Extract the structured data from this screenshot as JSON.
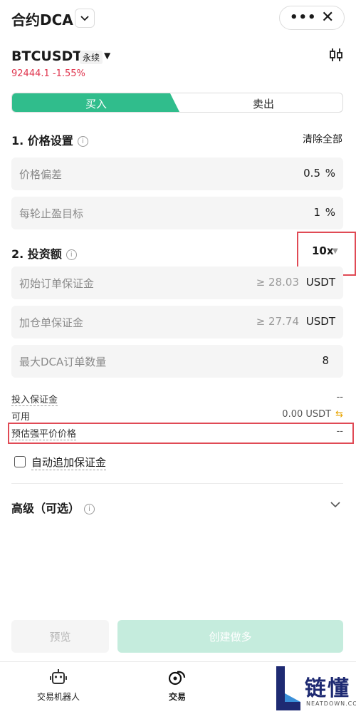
{
  "header": {
    "title": "合约DCA",
    "dropdown_icon": "chevron-down-icon",
    "more_icon": "more-dots-icon",
    "close_icon": "close-icon",
    "more_glyph": "•••",
    "close_glyph": "✕"
  },
  "instrument": {
    "symbol": "BTCUSDT",
    "type": "永续",
    "last_price": "92444.1",
    "change": "-1.55%",
    "change_color": "#e0364f"
  },
  "side_tabs": {
    "buy": "买入",
    "sell": "卖出",
    "active": "buy",
    "buy_color": "#30bd8c"
  },
  "section1": {
    "title": "1. 价格设置",
    "clear_all": "清除全部",
    "fields": [
      {
        "label": "价格偏差",
        "value": "0.5",
        "unit": "%"
      },
      {
        "label": "每轮止盈目标",
        "value": "1",
        "unit": "%"
      }
    ]
  },
  "section2": {
    "title": "2. 投资额",
    "leverage": "10x",
    "fields": [
      {
        "label": "初始订单保证金",
        "placeholder": "≥ 28.03",
        "unit": "USDT"
      },
      {
        "label": "加仓单保证金",
        "placeholder": "≥ 27.74",
        "unit": "USDT"
      },
      {
        "label": "最大DCA订单数量",
        "value": "8"
      }
    ]
  },
  "summary": {
    "margin_label": "投入保证金",
    "margin_value": "--",
    "available_label": "可用",
    "available_value": "0.00 USDT",
    "liq_label": "预估强平价价格",
    "liq_value": "--"
  },
  "auto_margin_label": "自动追加保证金",
  "advanced_label": "高级（可选）",
  "buttons": {
    "preview": "预览",
    "create": "创建做多"
  },
  "bottom_nav": {
    "bot": "交易机器人",
    "trade": "交易"
  },
  "watermark": {
    "text": "链懂",
    "sub": "NEATDOWN.COM"
  }
}
